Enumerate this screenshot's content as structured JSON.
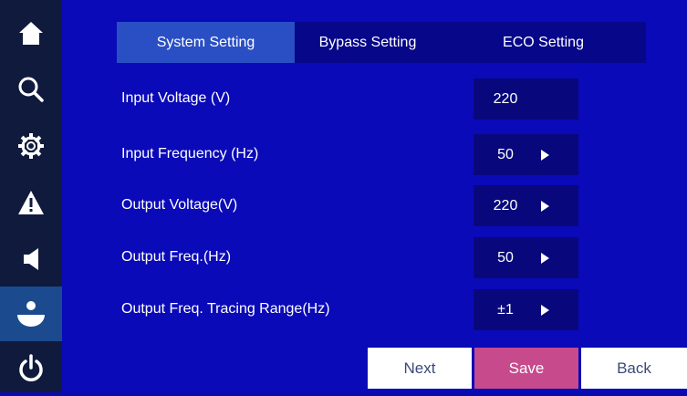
{
  "sidebar": {
    "icons": [
      "home-icon",
      "search-icon",
      "gear-icon",
      "warning-icon",
      "speaker-icon",
      "user-icon",
      "power-icon"
    ],
    "active_index": 5
  },
  "tabs": [
    {
      "label": "System Setting",
      "active": true
    },
    {
      "label": "Bypass Setting",
      "active": false
    },
    {
      "label": "ECO Setting",
      "active": false
    }
  ],
  "settings": [
    {
      "label": "Input Voltage (V)",
      "value": "220",
      "has_arrow": false
    },
    {
      "label": "Input Frequency (Hz)",
      "value": "50",
      "has_arrow": true
    },
    {
      "label": "Output Voltage(V)",
      "value": "220",
      "has_arrow": true
    },
    {
      "label": "Output Freq.(Hz)",
      "value": "50",
      "has_arrow": true
    },
    {
      "label": "Output Freq. Tracing Range(Hz)",
      "value": "±1",
      "has_arrow": true
    }
  ],
  "buttons": {
    "next": "Next",
    "save": "Save",
    "back": "Back"
  },
  "colors": {
    "background": "#0a0ab8",
    "sidebar": "#0f1a3d",
    "active_tab": "#2a4fc4",
    "save_button": "#c74a8c"
  }
}
